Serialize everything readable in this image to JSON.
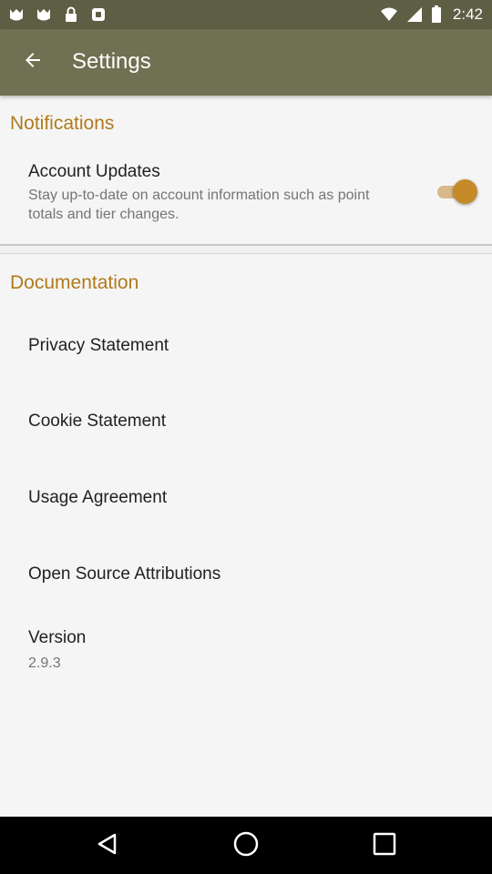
{
  "status_bar": {
    "time": "2:42",
    "left_icons": [
      "app-notification-icon",
      "app-notification-icon",
      "lock-icon",
      "app-icon"
    ],
    "right_icons": [
      "wifi-icon",
      "cellular-signal-icon",
      "battery-icon"
    ]
  },
  "app_bar": {
    "title": "Settings"
  },
  "notifications": {
    "header": "Notifications",
    "account_updates": {
      "title": "Account Updates",
      "description": "Stay up-to-date on account information such as point totals and tier changes.",
      "enabled": true
    }
  },
  "documentation": {
    "header": "Documentation",
    "items": [
      {
        "label": "Privacy Statement"
      },
      {
        "label": "Cookie Statement"
      },
      {
        "label": "Usage Agreement"
      },
      {
        "label": "Open Source Attributions"
      }
    ],
    "version": {
      "label": "Version",
      "value": "2.9.3"
    }
  },
  "colors": {
    "status_bar": "#5d5e44",
    "app_bar": "#707052",
    "accent": "#b07a1c",
    "toggle_thumb": "#c68a2a"
  }
}
